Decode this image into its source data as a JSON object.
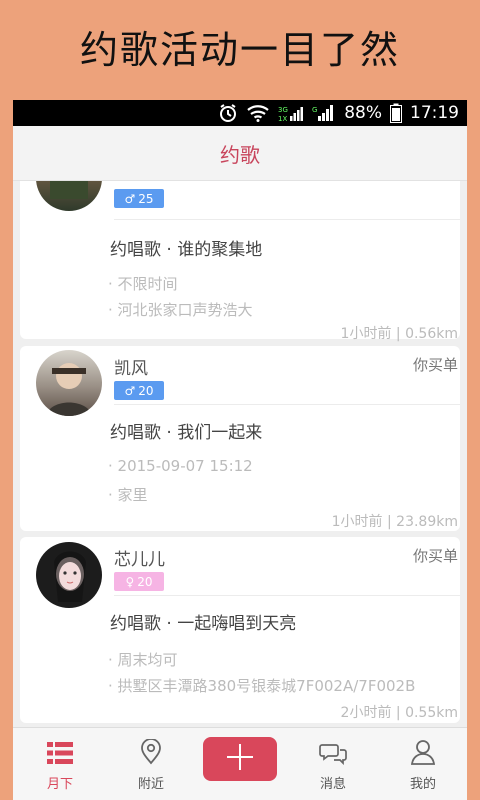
{
  "banner": {
    "text": "约歌活动一目了然"
  },
  "status_bar": {
    "network": "3G 1X",
    "battery": "88%",
    "time": "17:19"
  },
  "header": {
    "title": "约歌"
  },
  "cards": [
    {
      "name": "",
      "gender": "male",
      "gender_symbol": "♂",
      "age": "25",
      "pay": "",
      "title": "约唱歌 · 谁的聚集地",
      "time": "· 不限时间",
      "place": "· 河北张家口声势浩大",
      "footer": "1小时前  |  0.56km"
    },
    {
      "name": "凯风",
      "gender": "male",
      "gender_symbol": "♂",
      "age": "20",
      "pay": "你买单",
      "title": "约唱歌 · 我们一起来",
      "time": "· 2015-09-07 15:12",
      "place": "· 家里",
      "footer": "1小时前  |  23.89km"
    },
    {
      "name": "芯儿儿",
      "gender": "female",
      "gender_symbol": "♀",
      "age": "20",
      "pay": "你买单",
      "title": "约唱歌 · 一起嗨唱到天亮",
      "time": "· 周末均可",
      "place": "· 拱墅区丰潭路380号银泰城7F002A/7F002B",
      "footer": "2小时前  |  0.55km"
    }
  ],
  "tabbar": {
    "tabs": [
      {
        "label": "月下",
        "icon": "list-icon"
      },
      {
        "label": "附近",
        "icon": "location-pin-icon"
      },
      {
        "label": "消息",
        "icon": "chat-bubbles-icon"
      },
      {
        "label": "我的",
        "icon": "person-icon"
      }
    ],
    "add_symbol": "+"
  },
  "colors": {
    "accent": "#D9475B",
    "banner_bg": "#EDA27B",
    "male": "#5B9BF0",
    "female": "#F6B4E4"
  }
}
